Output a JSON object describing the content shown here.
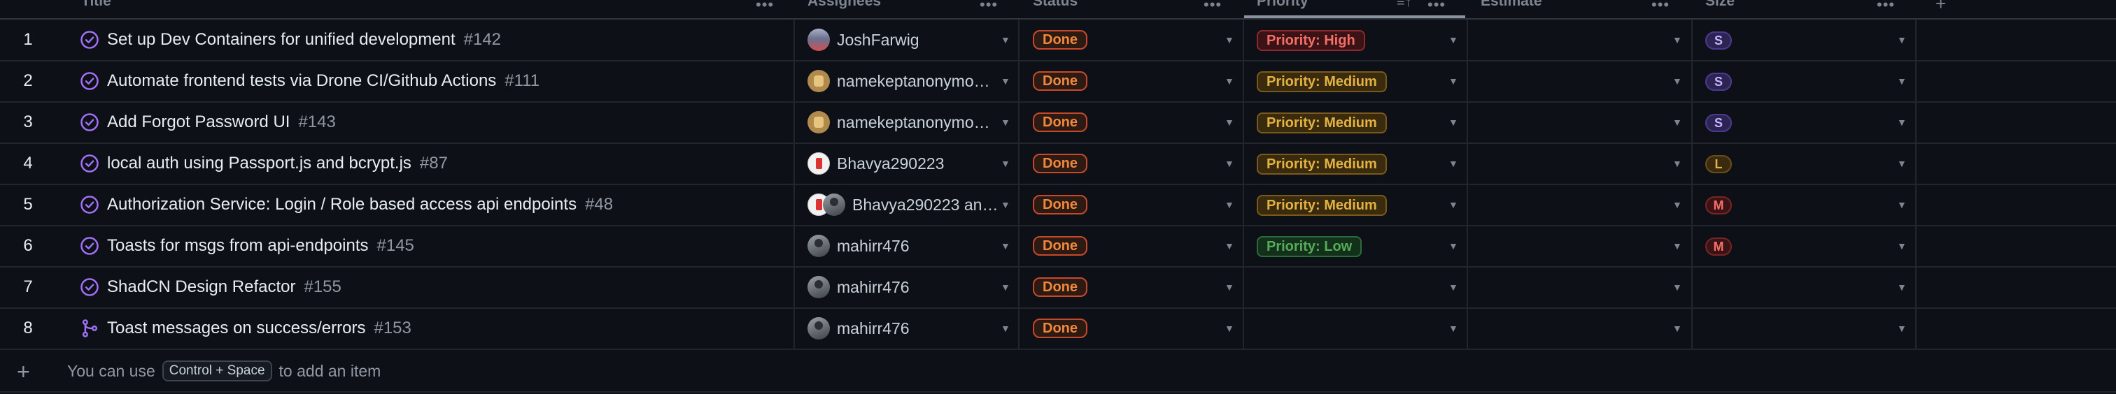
{
  "columns": {
    "title": "Title",
    "assignees": "Assignees",
    "status": "Status",
    "priority": "Priority",
    "estimate": "Estimate",
    "size": "Size"
  },
  "rows": [
    {
      "index": "1",
      "type": "closed-issue",
      "title": "Set up Dev Containers for unified development",
      "number": "#142",
      "assignee": "JoshFarwig",
      "avatar": "josh",
      "status": "Done",
      "priority": "Priority: High",
      "priority_level": "high",
      "size": "S",
      "size_level": "s"
    },
    {
      "index": "2",
      "type": "closed-issue",
      "title": "Automate frontend tests via Drone CI/Github Actions",
      "number": "#111",
      "assignee": "namekeptanonymo…",
      "avatar": "name",
      "status": "Done",
      "priority": "Priority: Medium",
      "priority_level": "medium",
      "size": "S",
      "size_level": "s"
    },
    {
      "index": "3",
      "type": "closed-issue",
      "title": "Add Forgot Password UI",
      "number": "#143",
      "assignee": "namekeptanonymo…",
      "avatar": "name",
      "status": "Done",
      "priority": "Priority: Medium",
      "priority_level": "medium",
      "size": "S",
      "size_level": "s"
    },
    {
      "index": "4",
      "type": "closed-issue",
      "title": "local auth using Passport.js and bcrypt.js",
      "number": "#87",
      "assignee": "Bhavya290223",
      "avatar": "bhavya",
      "status": "Done",
      "priority": "Priority: Medium",
      "priority_level": "medium",
      "size": "L",
      "size_level": "l"
    },
    {
      "index": "5",
      "type": "closed-issue",
      "title": "Authorization Service: Login / Role based access api endpoints",
      "number": "#48",
      "assignee": "Bhavya290223 an…",
      "avatar": "bhavya-multi",
      "status": "Done",
      "priority": "Priority: Medium",
      "priority_level": "medium",
      "size": "M",
      "size_level": "m"
    },
    {
      "index": "6",
      "type": "closed-issue",
      "title": "Toasts for msgs from api-endpoints",
      "number": "#145",
      "assignee": "mahirr476",
      "avatar": "mahi",
      "status": "Done",
      "priority": "Priority: Low",
      "priority_level": "low",
      "size": "M",
      "size_level": "m"
    },
    {
      "index": "7",
      "type": "closed-issue",
      "title": "ShadCN Design Refactor",
      "number": "#155",
      "assignee": "mahirr476",
      "avatar": "mahi",
      "status": "Done",
      "priority": "",
      "priority_level": "",
      "size": "",
      "size_level": ""
    },
    {
      "index": "8",
      "type": "merged-pr",
      "title": "Toast messages on success/errors",
      "number": "#153",
      "assignee": "mahirr476",
      "avatar": "mahi",
      "status": "Done",
      "priority": "",
      "priority_level": "",
      "size": "",
      "size_level": ""
    }
  ],
  "footer": {
    "prefix": "You can use",
    "shortcut": "Control + Space",
    "suffix": "to add an item"
  },
  "colors": {
    "background": "#0d1117",
    "status_done": "#f0883e",
    "priority_high": "#f47067",
    "priority_medium": "#e3b341",
    "priority_low": "#57ab5a",
    "issue_icon": "#a371f7"
  },
  "icons": {
    "closed_issue": "check-circle-icon",
    "merged_pr": "git-merge-icon",
    "column_menu": "kebab-icon",
    "sort": "sort-desc-icon",
    "add_field": "plus-icon",
    "dropdown": "chevron-down-icon"
  }
}
